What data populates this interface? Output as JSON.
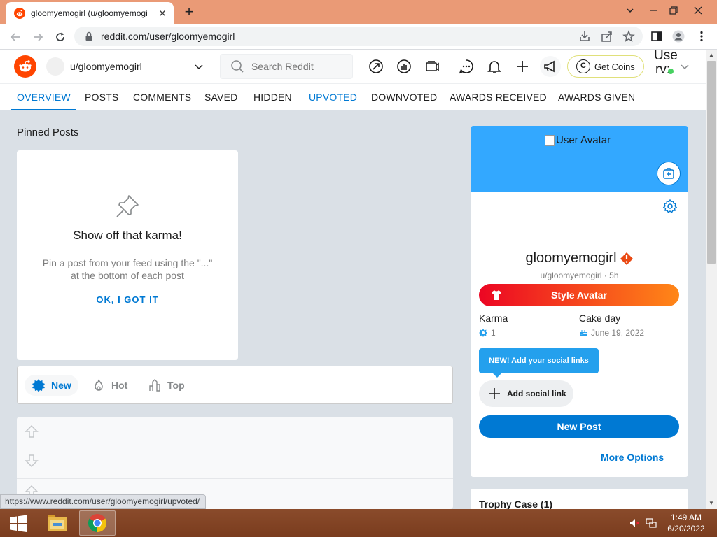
{
  "browser": {
    "tab_title": "gloomyemogirl (u/gloomyemogi",
    "url": "reddit.com/user/gloomyemogirl",
    "status_url": "https://www.reddit.com/user/gloomyemogirl/upvoted/"
  },
  "header": {
    "user_select_label": "u/gloomyemogirl",
    "search_placeholder": "Search Reddit",
    "coins_label": "Get Coins",
    "user_text_line1": "Use",
    "user_text_line2": "rv:"
  },
  "profile_tabs": [
    "OVERVIEW",
    "POSTS",
    "COMMENTS",
    "SAVED",
    "HIDDEN",
    "UPVOTED",
    "DOWNVOTED",
    "AWARDS RECEIVED",
    "AWARDS GIVEN"
  ],
  "pinned": {
    "section_title": "Pinned Posts",
    "heading": "Show off that karma!",
    "description": "Pin a post from your feed using the \"...\" at the bottom of each post",
    "ok_label": "OK, I GOT IT"
  },
  "sort": {
    "new_label": "New",
    "hot_label": "Hot",
    "top_label": "Top"
  },
  "profile_card": {
    "avatar_alt": "User Avatar",
    "display_name": "gloomyemogirl",
    "subline": "u/gloomyemogirl · 5h",
    "style_avatar_label": "Style Avatar",
    "karma_label": "Karma",
    "karma_value": "1",
    "cakeday_label": "Cake day",
    "cakeday_value": "June 19, 2022",
    "tooltip": "NEW! Add your social links",
    "add_social_label": "Add social link",
    "new_post_label": "New Post",
    "more_options_label": "More Options"
  },
  "trophy": {
    "title": "Trophy Case (1)"
  },
  "taskbar": {
    "time": "1:49 AM",
    "date": "6/20/2022"
  },
  "colors": {
    "reddit_orange": "#ff4500",
    "reddit_blue": "#0079d3",
    "banner": "#33a8ff",
    "titlebar": "#ea9a76"
  }
}
